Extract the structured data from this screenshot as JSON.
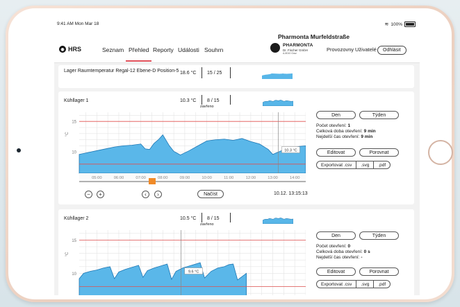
{
  "status": {
    "time": "9:41 AM  Mon Mar 18",
    "battery": "100%"
  },
  "nav": {
    "brand": "HRS",
    "items": [
      "Seznam",
      "Přehled",
      "Reporty",
      "Události",
      "Souhrn"
    ],
    "active": "Přehled",
    "company": "Pharmonta Murfeldstraße",
    "brand_name": "PHARMONTA",
    "brand_sub": "Dr. Fischer GmbH",
    "brand_small": "A-8010 Graz",
    "right_items": [
      "Provozovny",
      "Uživatelé"
    ],
    "logout": "Odhlásit"
  },
  "rows": [
    {
      "title": "Lager Raumtemperatur Regal-12 Ebene-D Position-5",
      "temp": "18.6 °C",
      "count": "15 / 25"
    }
  ],
  "cards": [
    {
      "title": "Kühllager 1",
      "temp": "10.3 °C",
      "count": "8 / 15",
      "status": "zavřeno",
      "den": "Den",
      "tyden": "Týden",
      "openings_label": "Počet otevření:",
      "openings": "1",
      "total_label": "Celková doba otevření:",
      "total": "9 min",
      "longest_label": "Nejdelší čas otevření:",
      "longest": "9 min",
      "edit": "Editovat",
      "compare": "Porovnat",
      "export": [
        "Exportovat .csv",
        ".svg",
        ".pdf"
      ],
      "zoom_out": "−",
      "zoom_in": "+",
      "prev": "‹",
      "next": "›",
      "load": "Načíst",
      "timestamp": "10.12. 13:15:13"
    },
    {
      "title": "Kühllager 2",
      "temp": "10.5 °C",
      "count": "8 / 15",
      "status": "zavřeno",
      "den": "Den",
      "tyden": "Týden",
      "openings_label": "Počet otevření:",
      "openings": "0",
      "total_label": "Celková doba otevření:",
      "total": "0 s",
      "longest_label": "Nejdelší čas otevření:",
      "longest": "-",
      "edit": "Editovat",
      "compare": "Porovnat",
      "export": [
        "Exportovat .csv",
        ".svg",
        ".pdf"
      ]
    }
  ],
  "chart_data": [
    {
      "type": "area",
      "ylabel": "°C",
      "y_ticks": [
        10,
        15
      ],
      "ylim": [
        6.5,
        16.5
      ],
      "x_ticks": [
        "05:00",
        "06:00",
        "07:00",
        "08:00",
        "09:00",
        "10:00",
        "11:00",
        "12:00",
        "13:00",
        "14:00"
      ],
      "threshold_lines": [
        15,
        8
      ],
      "x": [
        4.2,
        4.6,
        5.0,
        5.4,
        5.8,
        6.2,
        6.6,
        7.0,
        7.2,
        7.4,
        7.6,
        7.8,
        8.0,
        8.1,
        8.3,
        8.5,
        8.8,
        9.2,
        9.6,
        10.0,
        10.4,
        10.8,
        11.2,
        11.6,
        12.0,
        12.4,
        12.8,
        13.0,
        13.2,
        13.4,
        13.8,
        14.2,
        14.5
      ],
      "values": [
        9.6,
        9.9,
        10.2,
        10.5,
        10.8,
        11.0,
        11.1,
        11.3,
        10.5,
        10.4,
        11.4,
        12.0,
        12.8,
        12.2,
        11.0,
        10.1,
        9.5,
        10.2,
        11.0,
        11.8,
        12.0,
        12.1,
        11.9,
        12.2,
        11.7,
        11.3,
        10.4,
        9.6,
        9.9,
        10.2,
        10.6,
        10.9,
        11.0
      ],
      "annotation": "10.3 °C",
      "cursor_x": "13:15"
    },
    {
      "type": "area",
      "ylabel": "°C",
      "y_ticks": [
        10,
        15
      ],
      "ylim": [
        6.5,
        16.5
      ],
      "threshold_lines": [
        15,
        8
      ],
      "x": [
        4.2,
        4.4,
        4.7,
        5.0,
        5.3,
        5.6,
        5.8,
        6.0,
        6.3,
        6.6,
        6.9,
        7.1,
        7.3,
        7.6,
        7.9,
        8.2,
        8.4,
        8.6,
        8.9,
        9.2,
        9.5,
        9.7,
        9.9,
        10.2,
        10.5,
        10.8,
        11.0,
        11.2,
        11.4,
        11.6,
        11.8
      ],
      "values": [
        9.2,
        10.0,
        10.3,
        10.5,
        10.8,
        11.0,
        9.2,
        10.2,
        10.6,
        10.9,
        11.2,
        9.4,
        10.4,
        10.8,
        11.1,
        11.4,
        9.1,
        10.3,
        10.8,
        11.1,
        11.4,
        11.6,
        9.3,
        10.3,
        10.8,
        11.0,
        11.3,
        11.4,
        9.0,
        9.5,
        10.0
      ],
      "annotation": "9.6 °C",
      "cursor_x": "08:50"
    }
  ]
}
